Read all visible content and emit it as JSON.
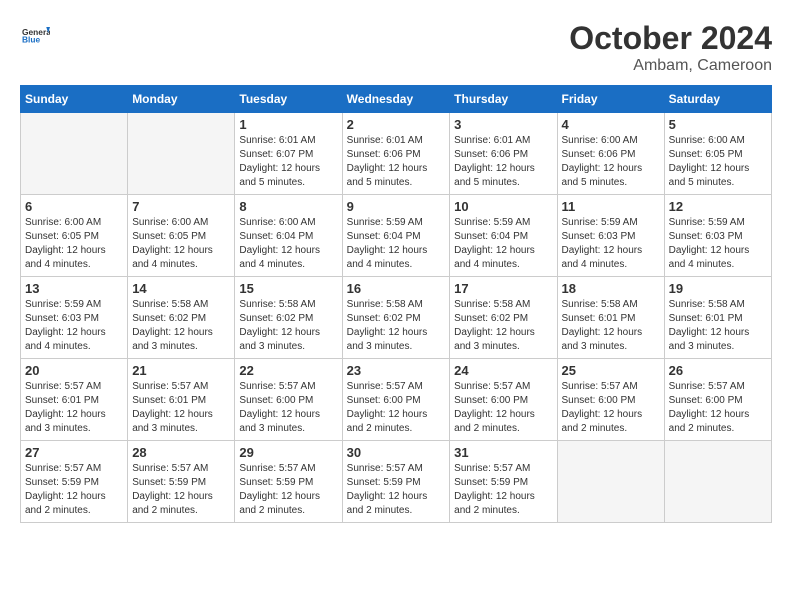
{
  "logo": {
    "text_general": "General",
    "text_blue": "Blue"
  },
  "header": {
    "month": "October 2024",
    "location": "Ambam, Cameroon"
  },
  "weekdays": [
    "Sunday",
    "Monday",
    "Tuesday",
    "Wednesday",
    "Thursday",
    "Friday",
    "Saturday"
  ],
  "weeks": [
    [
      {
        "day": "",
        "info": ""
      },
      {
        "day": "",
        "info": ""
      },
      {
        "day": "1",
        "info": "Sunrise: 6:01 AM\nSunset: 6:07 PM\nDaylight: 12 hours\nand 5 minutes."
      },
      {
        "day": "2",
        "info": "Sunrise: 6:01 AM\nSunset: 6:06 PM\nDaylight: 12 hours\nand 5 minutes."
      },
      {
        "day": "3",
        "info": "Sunrise: 6:01 AM\nSunset: 6:06 PM\nDaylight: 12 hours\nand 5 minutes."
      },
      {
        "day": "4",
        "info": "Sunrise: 6:00 AM\nSunset: 6:06 PM\nDaylight: 12 hours\nand 5 minutes."
      },
      {
        "day": "5",
        "info": "Sunrise: 6:00 AM\nSunset: 6:05 PM\nDaylight: 12 hours\nand 5 minutes."
      }
    ],
    [
      {
        "day": "6",
        "info": "Sunrise: 6:00 AM\nSunset: 6:05 PM\nDaylight: 12 hours\nand 4 minutes."
      },
      {
        "day": "7",
        "info": "Sunrise: 6:00 AM\nSunset: 6:05 PM\nDaylight: 12 hours\nand 4 minutes."
      },
      {
        "day": "8",
        "info": "Sunrise: 6:00 AM\nSunset: 6:04 PM\nDaylight: 12 hours\nand 4 minutes."
      },
      {
        "day": "9",
        "info": "Sunrise: 5:59 AM\nSunset: 6:04 PM\nDaylight: 12 hours\nand 4 minutes."
      },
      {
        "day": "10",
        "info": "Sunrise: 5:59 AM\nSunset: 6:04 PM\nDaylight: 12 hours\nand 4 minutes."
      },
      {
        "day": "11",
        "info": "Sunrise: 5:59 AM\nSunset: 6:03 PM\nDaylight: 12 hours\nand 4 minutes."
      },
      {
        "day": "12",
        "info": "Sunrise: 5:59 AM\nSunset: 6:03 PM\nDaylight: 12 hours\nand 4 minutes."
      }
    ],
    [
      {
        "day": "13",
        "info": "Sunrise: 5:59 AM\nSunset: 6:03 PM\nDaylight: 12 hours\nand 4 minutes."
      },
      {
        "day": "14",
        "info": "Sunrise: 5:58 AM\nSunset: 6:02 PM\nDaylight: 12 hours\nand 3 minutes."
      },
      {
        "day": "15",
        "info": "Sunrise: 5:58 AM\nSunset: 6:02 PM\nDaylight: 12 hours\nand 3 minutes."
      },
      {
        "day": "16",
        "info": "Sunrise: 5:58 AM\nSunset: 6:02 PM\nDaylight: 12 hours\nand 3 minutes."
      },
      {
        "day": "17",
        "info": "Sunrise: 5:58 AM\nSunset: 6:02 PM\nDaylight: 12 hours\nand 3 minutes."
      },
      {
        "day": "18",
        "info": "Sunrise: 5:58 AM\nSunset: 6:01 PM\nDaylight: 12 hours\nand 3 minutes."
      },
      {
        "day": "19",
        "info": "Sunrise: 5:58 AM\nSunset: 6:01 PM\nDaylight: 12 hours\nand 3 minutes."
      }
    ],
    [
      {
        "day": "20",
        "info": "Sunrise: 5:57 AM\nSunset: 6:01 PM\nDaylight: 12 hours\nand 3 minutes."
      },
      {
        "day": "21",
        "info": "Sunrise: 5:57 AM\nSunset: 6:01 PM\nDaylight: 12 hours\nand 3 minutes."
      },
      {
        "day": "22",
        "info": "Sunrise: 5:57 AM\nSunset: 6:00 PM\nDaylight: 12 hours\nand 3 minutes."
      },
      {
        "day": "23",
        "info": "Sunrise: 5:57 AM\nSunset: 6:00 PM\nDaylight: 12 hours\nand 2 minutes."
      },
      {
        "day": "24",
        "info": "Sunrise: 5:57 AM\nSunset: 6:00 PM\nDaylight: 12 hours\nand 2 minutes."
      },
      {
        "day": "25",
        "info": "Sunrise: 5:57 AM\nSunset: 6:00 PM\nDaylight: 12 hours\nand 2 minutes."
      },
      {
        "day": "26",
        "info": "Sunrise: 5:57 AM\nSunset: 6:00 PM\nDaylight: 12 hours\nand 2 minutes."
      }
    ],
    [
      {
        "day": "27",
        "info": "Sunrise: 5:57 AM\nSunset: 5:59 PM\nDaylight: 12 hours\nand 2 minutes."
      },
      {
        "day": "28",
        "info": "Sunrise: 5:57 AM\nSunset: 5:59 PM\nDaylight: 12 hours\nand 2 minutes."
      },
      {
        "day": "29",
        "info": "Sunrise: 5:57 AM\nSunset: 5:59 PM\nDaylight: 12 hours\nand 2 minutes."
      },
      {
        "day": "30",
        "info": "Sunrise: 5:57 AM\nSunset: 5:59 PM\nDaylight: 12 hours\nand 2 minutes."
      },
      {
        "day": "31",
        "info": "Sunrise: 5:57 AM\nSunset: 5:59 PM\nDaylight: 12 hours\nand 2 minutes."
      },
      {
        "day": "",
        "info": ""
      },
      {
        "day": "",
        "info": ""
      }
    ]
  ]
}
